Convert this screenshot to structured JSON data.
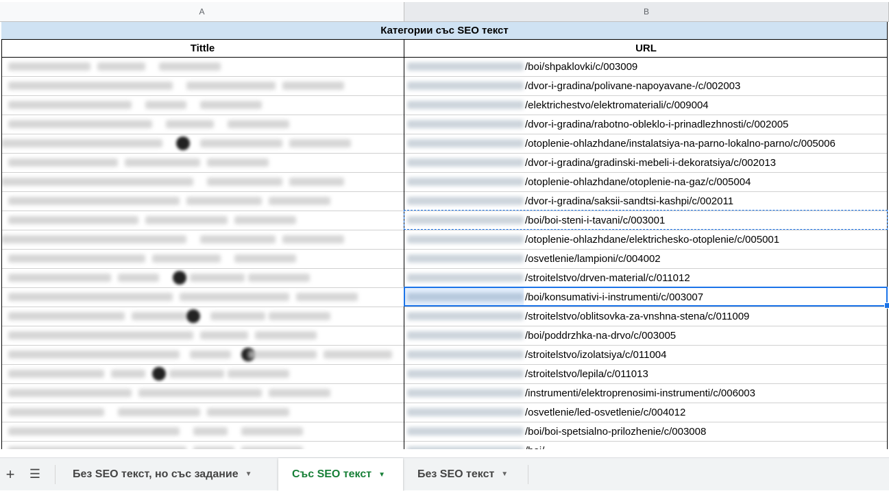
{
  "columns": [
    "A",
    "B"
  ],
  "title": "Категории със SEO текст",
  "headers": {
    "tittle": "Tittle",
    "url": "URL"
  },
  "rows": [
    "/boi/shpaklovki/c/003009",
    "/dvor-i-gradina/polivane-napoyavane-/c/002003",
    "/elektrichestvo/elektromateriali/c/009004",
    "/dvor-i-gradina/rabotno-obleklo-i-prinadlezhnosti/c/002005",
    "/otoplenie-ohlazhdane/instalatsiya-na-parno-lokalno-parno/c/005006",
    "/dvor-i-gradina/gradinski-mebeli-i-dekoratsiya/c/002013",
    "/otoplenie-ohlazhdane/otoplenie-na-gaz/c/005004",
    "/dvor-i-gradina/saksii-sandtsi-kashpi/c/002011",
    "/boi/boi-steni-i-tavani/c/003001",
    "/otoplenie-ohlazhdane/elektrichesko-otoplenie/c/005001",
    "/osvetlenie/lampioni/c/004002",
    "/stroitelstvo/drven-material/c/011012",
    "/boi/konsumativi-i-instrumenti/c/003007",
    "/stroitelstvo/oblitsovka-za-vnshna-stena/c/011009",
    "/boi/poddrzhka-na-drvo/c/003005",
    "/stroitelstvo/izolatsiya/c/011004",
    "/stroitelstvo/lepila/c/011013",
    "/instrumenti/elektroprenosimi-instrumenti/c/006003",
    "/osvetlenie/led-osvetlenie/c/004012",
    "/boi/boi-spetsialno-prilozhenie/c/003008",
    "/boi/..."
  ],
  "tabs": [
    {
      "label": "Без SEO текст, но със задание",
      "active": false
    },
    {
      "label": "Със SEO текст",
      "active": true
    },
    {
      "label": "Без SEO текст",
      "active": false
    }
  ],
  "colors": {
    "accent": "#1a73e8",
    "active_tab": "#188038",
    "title_bg": "#cfe2f3"
  },
  "icons": {
    "add": "plus-icon",
    "list": "hamburger-icon",
    "tab_menu": "chevron-down-icon"
  }
}
